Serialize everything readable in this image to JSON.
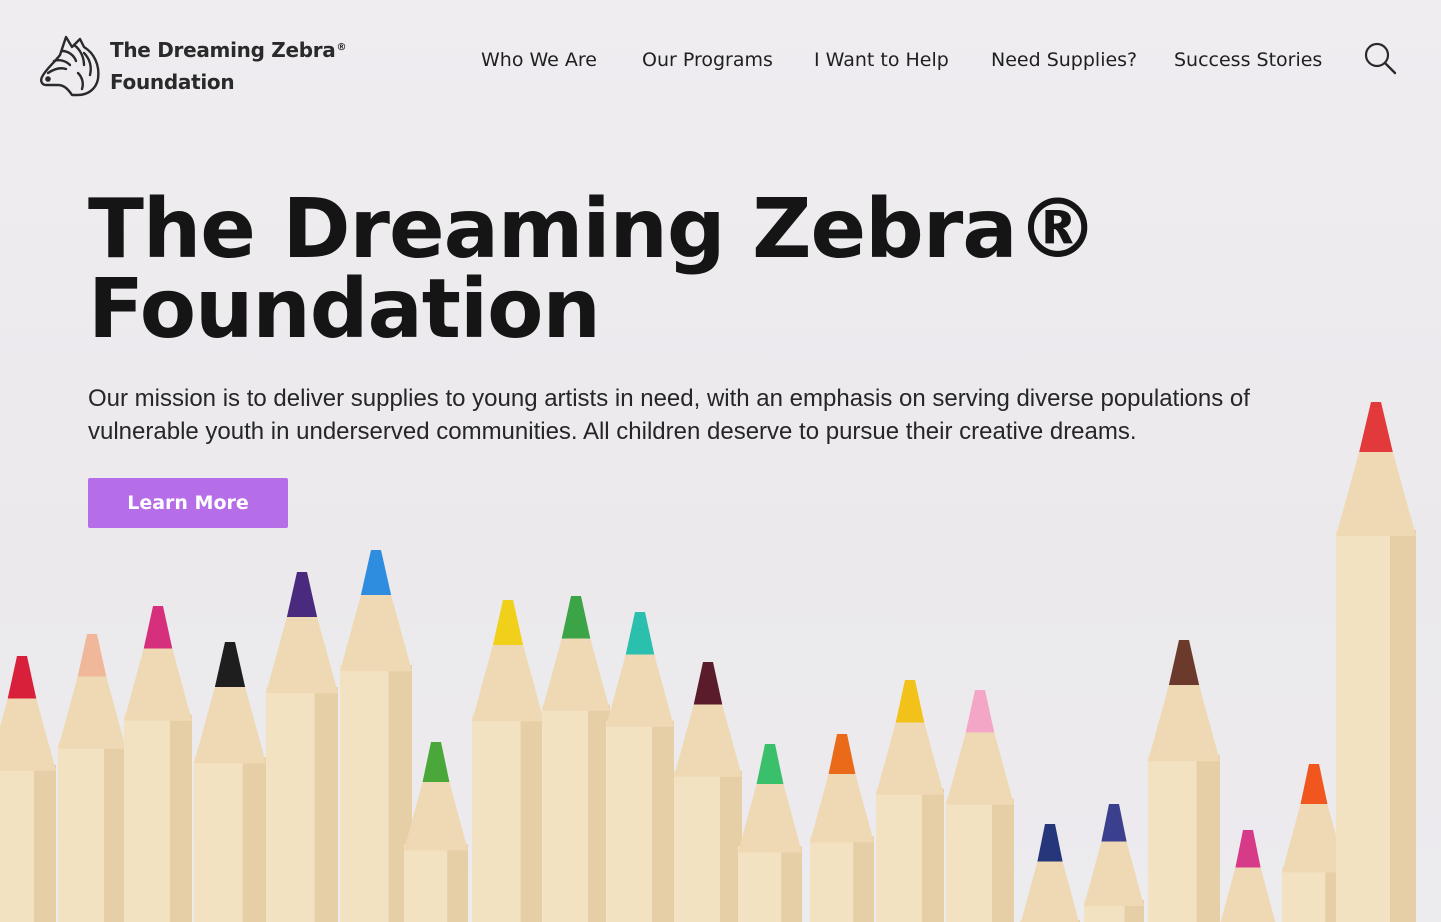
{
  "brand": {
    "line1": "The Dreaming Zebra",
    "reg": "®",
    "line2": "Foundation",
    "logo_icon": "zebra-head-icon"
  },
  "nav": {
    "items": [
      "Who We Are",
      "Our Programs",
      "I Want to Help",
      "Need Supplies?",
      "Success Stories"
    ],
    "search_icon": "search-icon"
  },
  "hero": {
    "title_line1": "The Dreaming Zebra®",
    "title_line2": "Foundation",
    "mission_line1": "Our mission is to deliver supplies to young artists in need, with an emphasis on serving diverse populations of",
    "mission_line2": "vulnerable youth in underserved communities.  All children deserve to pursue their creative dreams.",
    "cta_label": "Learn More",
    "background_image": "colored-pencils-photo"
  },
  "colors": {
    "background": "#edebee",
    "accent": "#b56ee8",
    "text": "#151515",
    "wood": "#efd9b4",
    "pencil_tips": [
      "#d8203a",
      "#f0b79a",
      "#d62f7c",
      "#1e1e1e",
      "#4a2a7e",
      "#2f8de0",
      "#4aa83a",
      "#f0d01a",
      "#3aa446",
      "#2bbfae",
      "#5a1b2a",
      "#3abf6a",
      "#ea6a1a",
      "#f2c21a",
      "#f4a6c6",
      "#26367a",
      "#3a3f8e",
      "#6b3a2a",
      "#d83a8a",
      "#f0561e",
      "#e23a3a"
    ]
  }
}
